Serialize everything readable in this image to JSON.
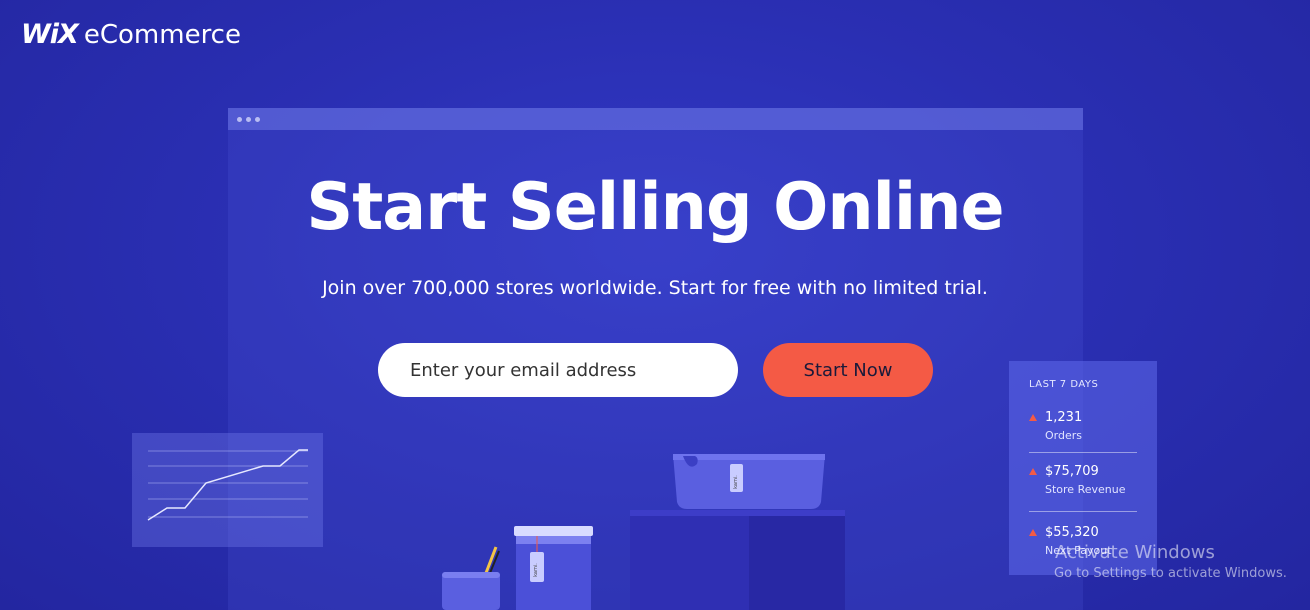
{
  "brand": {
    "wix": "WiX",
    "product": "eCommerce"
  },
  "hero": {
    "title": "Start Selling Online",
    "subtitle": "Join over 700,000 stores worldwide. Start for free with no limited trial."
  },
  "signup": {
    "email_placeholder": "Enter your email address",
    "button_label": "Start Now"
  },
  "stats": {
    "heading": "LAST 7 DAYS",
    "items": [
      {
        "value": "1,231",
        "label": "Orders"
      },
      {
        "value": "$75,709",
        "label": "Store Revenue"
      },
      {
        "value": "$55,320",
        "label": "Next Payout"
      }
    ]
  },
  "product_tag": "kami.",
  "windows_watermark": {
    "title": "Activate Windows",
    "subtitle": "Go to Settings to activate Windows."
  },
  "colors": {
    "background": "#2a2fb3",
    "accent": "#f45a45",
    "text": "#ffffff"
  }
}
